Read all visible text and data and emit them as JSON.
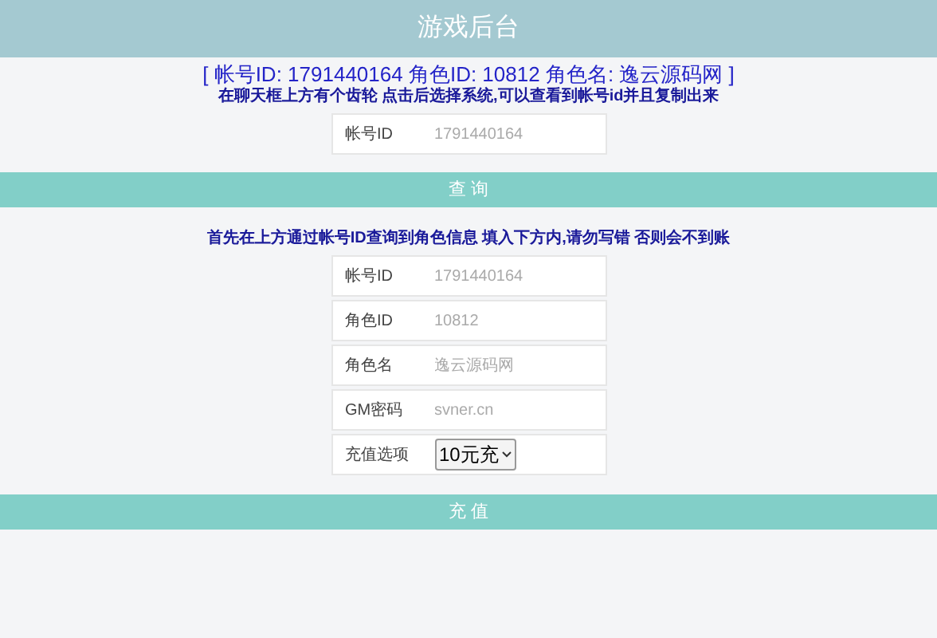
{
  "header": {
    "title": "游戏后台"
  },
  "info": "[ 帐号ID: 1791440164 角色ID: 10812 角色名: 逸云源码网 ]",
  "hint": "在聊天框上方有个齿轮 点击后选择系统,可以查看到帐号id并且复制出来",
  "query_form": {
    "fields": [
      {
        "label": "帐号ID",
        "placeholder": "1791440164"
      }
    ],
    "button": "查 询"
  },
  "notice": "首先在上方通过帐号ID查询到角色信息 填入下方内,请勿写错 否则会不到账",
  "recharge_form": {
    "fields": [
      {
        "kind": "input",
        "label": "帐号ID",
        "placeholder": "1791440164"
      },
      {
        "kind": "input",
        "label": "角色ID",
        "placeholder": "10812"
      },
      {
        "kind": "input",
        "label": "角色名",
        "placeholder": "逸云源码网"
      },
      {
        "kind": "input",
        "label": "GM密码",
        "placeholder": "svner.cn"
      },
      {
        "kind": "select",
        "label": "充值选项",
        "value": "10元充"
      }
    ],
    "button": "充 值"
  }
}
